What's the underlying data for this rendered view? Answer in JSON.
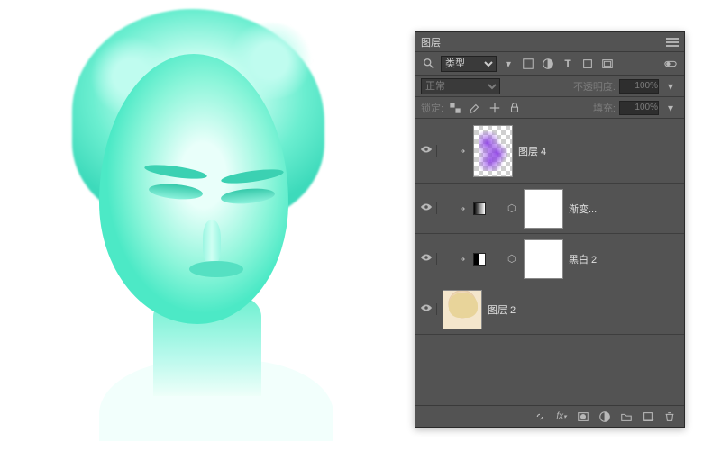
{
  "panel": {
    "title": "图层",
    "filter_label": "类型",
    "blend_mode": "正常",
    "opacity_label": "不透明度:",
    "opacity_value": "100%",
    "lock_label": "锁定:",
    "fill_label": "填充:",
    "fill_value": "100%",
    "layers": [
      {
        "name": "图层 4"
      },
      {
        "name": "渐变..."
      },
      {
        "name": "黑白 2"
      },
      {
        "name": "图层 2"
      }
    ]
  }
}
